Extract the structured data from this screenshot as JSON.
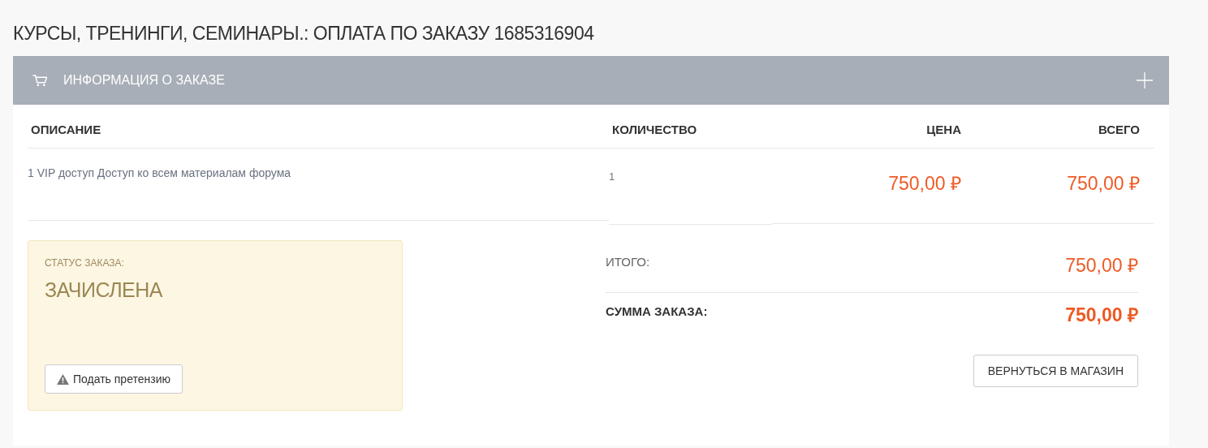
{
  "page_title": "КУРСЫ, ТРЕНИНГИ, СЕМИНАРЫ.: ОПЛАТА ПО ЗАКАЗУ 1685316904",
  "panel": {
    "title": "ИНФОРМАЦИЯ О ЗАКАЗЕ",
    "expanded": false
  },
  "table": {
    "columns": [
      "ОПИСАНИЕ",
      "КОЛИЧЕСТВО",
      "ЦЕНА",
      "ВСЕГО"
    ],
    "rows": [
      {
        "description": "1 VIP доступ Доступ ко всем материалам форума",
        "quantity": "1",
        "price": "750,00 ₽",
        "total": "750,00 ₽"
      }
    ]
  },
  "status": {
    "label": "СТАТУС ЗАКАЗА:",
    "value": "ЗАЧИСЛЕНА",
    "button": "Подать претензию"
  },
  "totals": [
    {
      "label": "ИТОГО:",
      "value": "750,00 ₽",
      "kind": "subtotal"
    },
    {
      "label": "СУММА ЗАКАЗА:",
      "value": "750,00 ₽",
      "kind": "grand"
    }
  ],
  "back_button": "ВЕРНУТЬСЯ В МАГАЗИН"
}
